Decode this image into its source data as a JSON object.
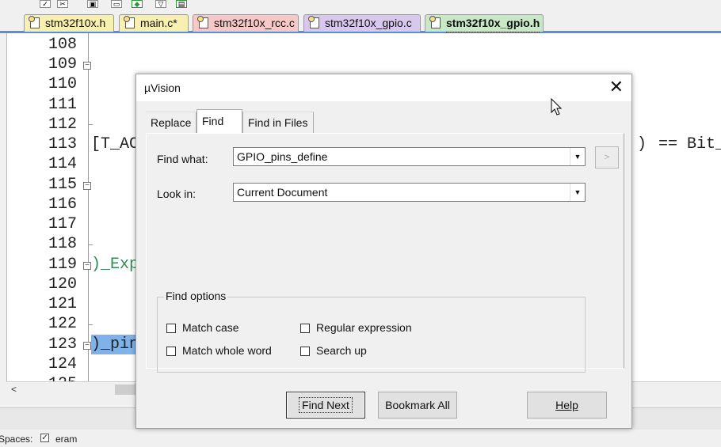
{
  "toolbar": {
    "icons": [
      "checkbox-icon",
      "tools-icon",
      "build-icon",
      "download-icon",
      "debug-icon",
      "flash-icon"
    ]
  },
  "tabs": [
    {
      "label": "stm32f10x.h",
      "color": "#f7f0b0"
    },
    {
      "label": "main.c*",
      "color": "#f7f0b0"
    },
    {
      "label": "stm32f10x_rcc.c",
      "color": "#f7c8c8"
    },
    {
      "label": "stm32f10x_gpio.c",
      "color": "#d8c8ee"
    },
    {
      "label": "stm32f10x_gpio.h",
      "color": "#c8e8c8",
      "active": true
    }
  ],
  "editor": {
    "line_numbers": [
      "108",
      "109",
      "110",
      "111",
      "112",
      "113",
      "114",
      "115",
      "116",
      "117",
      "118",
      "119",
      "120",
      "121",
      "122",
      "123",
      "124",
      "125"
    ],
    "code_fragments": {
      "line113_left": "[T_AC",
      "line113_right": "== Bit_",
      "line113_right_partial": ")",
      "line119": ")_Exp",
      "line123": ")_pin"
    }
  },
  "status": {
    "spaces_label": "Spaces:",
    "eram_label": "eram"
  },
  "dialog": {
    "title": "µVision",
    "close": "✕",
    "tabs": [
      "Replace",
      "Find",
      "Find in Files"
    ],
    "find_what_label": "Find what:",
    "find_what_value": "GPIO_pins_define",
    "look_in_label": "Look in:",
    "look_in_value": "Current Document",
    "more_button": ">",
    "find_options_legend": "Find options",
    "options": {
      "match_case": "Match case",
      "match_whole_word": "Match whole word",
      "regular_expression": "Regular expression",
      "search_up": "Search up"
    },
    "buttons": {
      "find_next": "Find Next",
      "bookmark_all": "Bookmark All",
      "help": "Help"
    }
  },
  "colors": {
    "selection": "#7fb2e8",
    "comment_green": "#2e8b57",
    "tab_border_active": "#5b8ed0"
  }
}
